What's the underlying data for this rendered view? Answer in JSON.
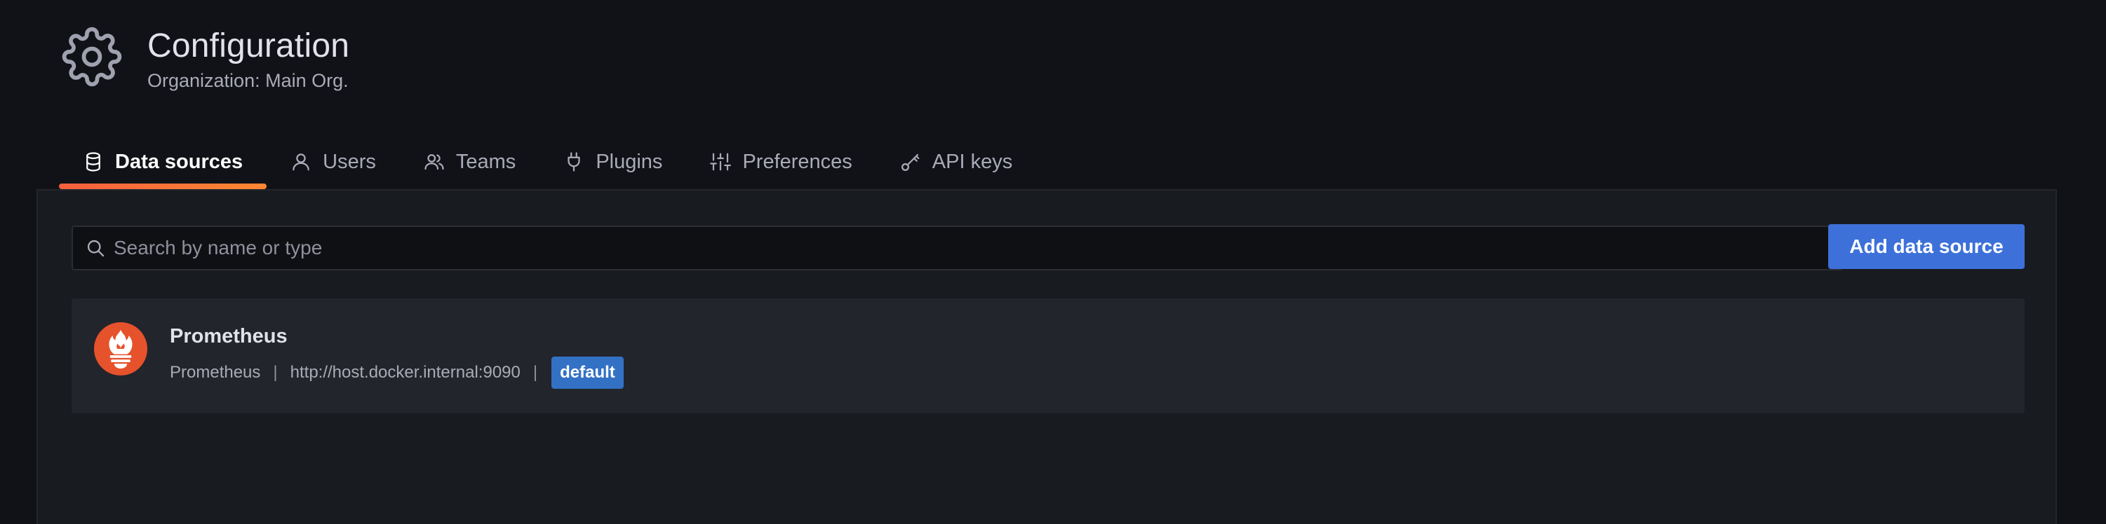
{
  "header": {
    "icon": "gear-icon",
    "title": "Configuration",
    "subtitle": "Organization: Main Org."
  },
  "tabs": [
    {
      "label": "Data sources",
      "icon": "database-icon",
      "active": true
    },
    {
      "label": "Users",
      "icon": "user-icon",
      "active": false
    },
    {
      "label": "Teams",
      "icon": "users-group-icon",
      "active": false
    },
    {
      "label": "Plugins",
      "icon": "plug-icon",
      "active": false
    },
    {
      "label": "Preferences",
      "icon": "sliders-icon",
      "active": false
    },
    {
      "label": "API keys",
      "icon": "key-icon",
      "active": false
    }
  ],
  "search": {
    "placeholder": "Search by name or type",
    "value": ""
  },
  "add_button": {
    "label": "Add data source"
  },
  "datasources": [
    {
      "name": "Prometheus",
      "logo": "prometheus-logo-icon",
      "type": "Prometheus",
      "separator": "|",
      "url": "http://host.docker.internal:9090",
      "badge": "default"
    }
  ],
  "colors": {
    "background": "#111217",
    "panel": "#181b1f",
    "card": "#22252b",
    "accent": "#3d71d9",
    "tab_underline": "#f55f3e",
    "badge": "#3371c5",
    "prometheus": "#e6522c"
  }
}
